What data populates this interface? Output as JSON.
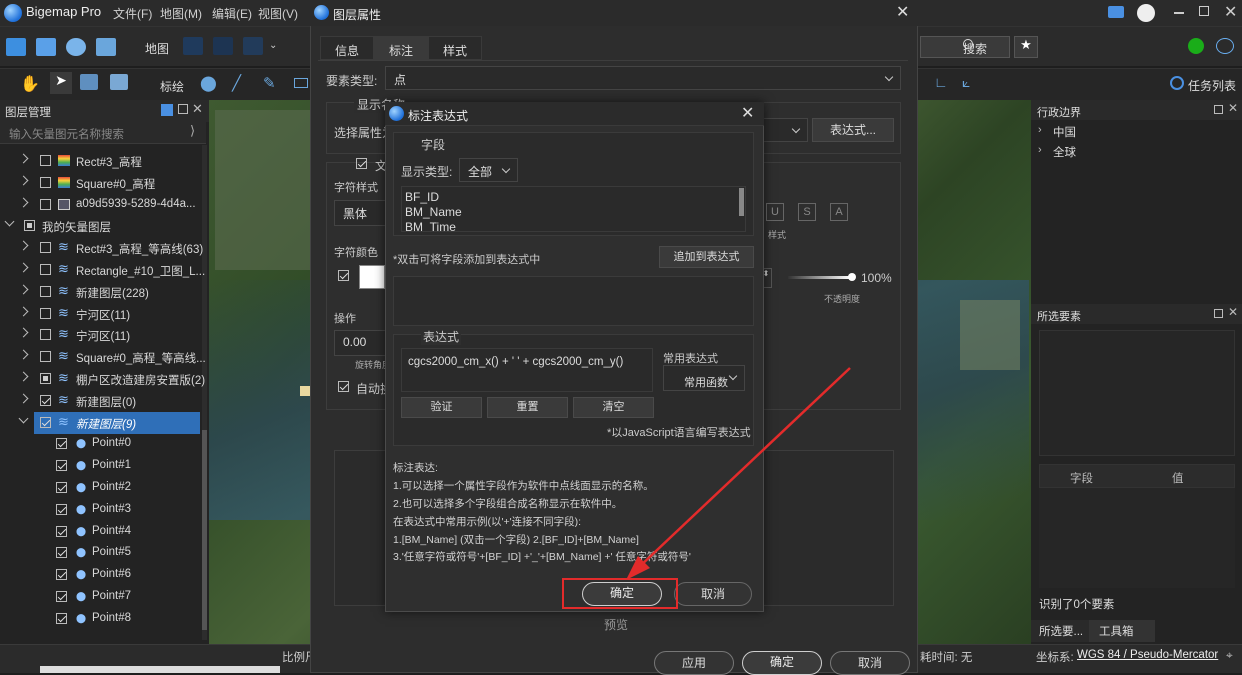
{
  "app": {
    "title": "Bigemap Pro"
  },
  "menus": [
    "文件(F)",
    "地图(M)",
    "编辑(E)",
    "视图(V)"
  ],
  "toolbar": {
    "map_label": "地图",
    "draw_label": "标绘",
    "search_label": "搜索",
    "task_list": "任务列表"
  },
  "layer_panel": {
    "title": "图层管理",
    "search_placeholder": "输入矢量图元名称搜索",
    "items": [
      {
        "label": "Rect#3_高程",
        "checked": false
      },
      {
        "label": "Square#0_高程",
        "checked": false
      },
      {
        "label": "a09d5939-5289-4d4a...",
        "checked": false
      },
      {
        "label": "我的矢量图层",
        "checked": "partial"
      },
      {
        "label": "Rect#3_高程_等高线(63)",
        "checked": false
      },
      {
        "label": "Rectangle_#10_卫图_L...",
        "checked": false
      },
      {
        "label": "新建图层(228)",
        "checked": false
      },
      {
        "label": "宁河区(11)",
        "checked": false
      },
      {
        "label": "宁河区(11)",
        "checked": false
      },
      {
        "label": "Square#0_高程_等高线...",
        "checked": false
      },
      {
        "label": "棚户区改造建房安置版(2)",
        "checked": "partial"
      },
      {
        "label": "新建图层(0)",
        "checked": true
      },
      {
        "label": "新建图层(9)",
        "checked": true
      },
      {
        "label": "Point#0",
        "checked": true
      },
      {
        "label": "Point#1",
        "checked": true
      },
      {
        "label": "Point#2",
        "checked": true
      },
      {
        "label": "Point#3",
        "checked": true
      },
      {
        "label": "Point#4",
        "checked": true
      },
      {
        "label": "Point#5",
        "checked": true
      },
      {
        "label": "Point#6",
        "checked": true
      },
      {
        "label": "Point#7",
        "checked": true
      },
      {
        "label": "Point#8",
        "checked": true
      }
    ]
  },
  "right_panel": {
    "admin_title": "行政边界",
    "admin_items": [
      "中国",
      "全球"
    ],
    "selected_title": "所选要素",
    "col_field": "字段",
    "col_value": "值",
    "recognized": "识别了0个要素",
    "tab_selected": "所选要...",
    "tab_toolbox": "工具箱"
  },
  "status": {
    "scale": "比例尺",
    "time": "耗时间: 无",
    "coord_label": "坐标系:",
    "coord_value": "WGS 84 / Pseudo-Mercator"
  },
  "props_dialog": {
    "title": "图层属性",
    "tabs": [
      "信息",
      "标注",
      "样式"
    ],
    "feature_type_label": "要素类型:",
    "feature_type_value": "点",
    "show_name": "显示名称",
    "select_attr": "选择属性为",
    "expr_button": "表达式...",
    "text_check": "文",
    "font_style": "字符样式",
    "font_value": "黑体",
    "style_small": "样式",
    "font_color": "字符颜色",
    "opacity_value": "100%",
    "opacity_label": "不透明度",
    "operation": "操作",
    "rotation_value": "0.00",
    "rotation_label": "旋转角度",
    "auto_label": "自动换",
    "preview": "预览",
    "apply": "应用",
    "ok": "确定",
    "cancel": "取消"
  },
  "expr_dialog": {
    "title": "标注表达式",
    "field_section": "字段",
    "display_type_label": "显示类型:",
    "display_type_value": "全部",
    "fields": [
      "BF_ID",
      "BM_Name",
      "BM_Time"
    ],
    "hint": "*双击可将字段添加到表达式中",
    "add_button": "追加到表达式",
    "expr_section": "表达式",
    "expression": "cgcs2000_cm_x()  + ' ' + cgcs2000_cm_y()",
    "common_expr": "常用表达式",
    "common_func": "常用函数",
    "validate": "验证",
    "reset": "重置",
    "clear": "清空",
    "js_note": "*以JavaScript语言编写表达式",
    "notes": [
      "标注表达:",
      "1.可以选择一个属性字段作为软件中点线面显示的名称。",
      "2.也可以选择多个字段组合成名称显示在软件中。",
      "在表达式中常用示例(以'+'连接不同字段):",
      "1.[BM_Name]  (双击一个字段)        2.[BF_ID]+[BM_Name]",
      "3.'任意字符或符号'+[BF_ID] +'_'+[BM_Name] +' 任意字符或符号'"
    ],
    "ok": "确定",
    "cancel": "取消"
  },
  "colors": {
    "accent": "#3a7bd5",
    "highlight_border": "#e32b2b",
    "arrow": "#e32b2b"
  }
}
